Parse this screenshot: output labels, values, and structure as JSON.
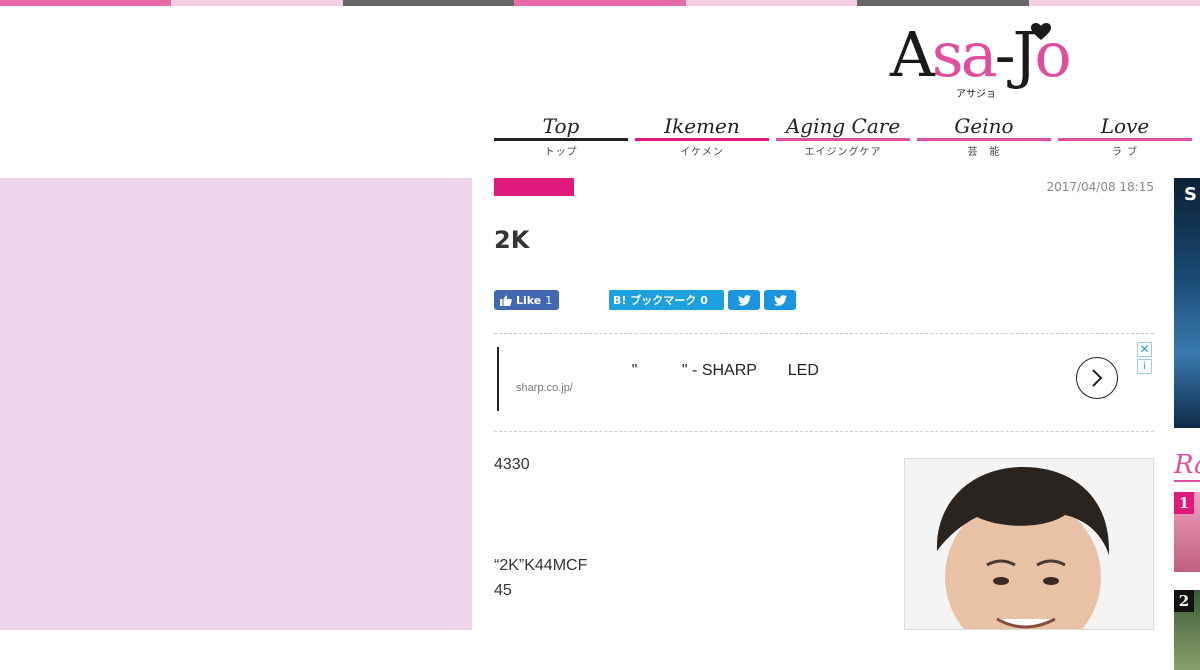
{
  "theme": {
    "accent_pink": "#e0197c",
    "logo_pink": "#e04ea0",
    "sidebar_pink": "#efd5ec",
    "top_stripe_colors": [
      "#e86aa8",
      "#f2cfe2",
      "#666666",
      "#e86aa8",
      "#f2cfe2",
      "#666666",
      "#f2cfe2"
    ]
  },
  "logo": {
    "part1": "A",
    "part2": "sa",
    "part3": "-J",
    "part4": "o",
    "kana": "アサジョ"
  },
  "nav": [
    {
      "en": "Top",
      "jp": "トップ",
      "line_color": "#222222"
    },
    {
      "en": "Ikemen",
      "jp": "イケメン",
      "line_color": "#e0197c"
    },
    {
      "en": "Aging Care",
      "jp": "エイジングケア",
      "line_color": "#e04ea0"
    },
    {
      "en": "Geino",
      "jp": "芸　能",
      "line_color": "#e04ea0"
    },
    {
      "en": "Love",
      "jp": "ラ ブ",
      "line_color": "#e04ea0"
    }
  ],
  "article": {
    "date": "2017/04/08 18:15",
    "title": "2K",
    "body_line1": "4330",
    "body_line2": "“2K”K44MCF",
    "body_line3": "45"
  },
  "social": {
    "fb_label": "Like",
    "fb_count": "1",
    "hatena_label": "B! ブックマーク",
    "hatena_count": "0"
  },
  "ad": {
    "headline": "             \"          \" - SHARP       LED",
    "url": "sharp.co.jp/",
    "close_glyph": "✕",
    "info_glyph": "i"
  },
  "sidebar": {
    "ad_letter": "S",
    "ranking_head": "Ra",
    "ranks": [
      "1",
      "2"
    ]
  }
}
